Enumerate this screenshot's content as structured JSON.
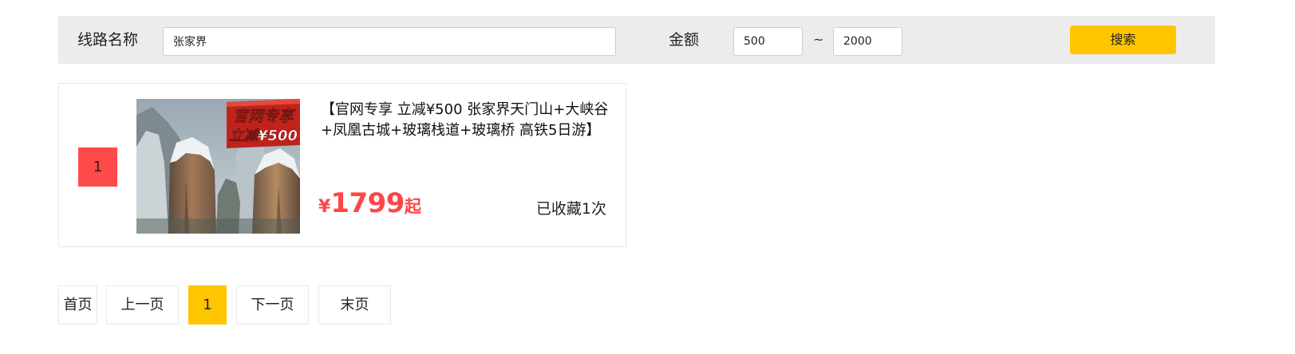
{
  "search": {
    "route_label": "线路名称",
    "route_value": "张家界",
    "amount_label": "金额",
    "min_value": "500",
    "range_separator": "~",
    "max_value": "2000",
    "search_button_label": "搜索"
  },
  "results": [
    {
      "rank": "1",
      "image_overlay_line1": "官网专享",
      "image_overlay_line2": "立减¥500",
      "title": "【官网专享 立减¥500 张家界天门山+大峡谷+凤凰古城+玻璃栈道+玻璃桥 高铁5日游】",
      "price_currency": "¥",
      "price_amount": "1799",
      "price_suffix": "起",
      "favorites_text": "已收藏1次"
    }
  ],
  "pagination": {
    "first_label": "首页",
    "prev_label": "上一页",
    "current_page": "1",
    "next_label": "下一页",
    "last_label": "末页"
  },
  "colors": {
    "accent": "#ffc600",
    "price": "#ff4646",
    "rank_badge": "#ff4a4a",
    "search_bar_bg": "#ececec"
  }
}
